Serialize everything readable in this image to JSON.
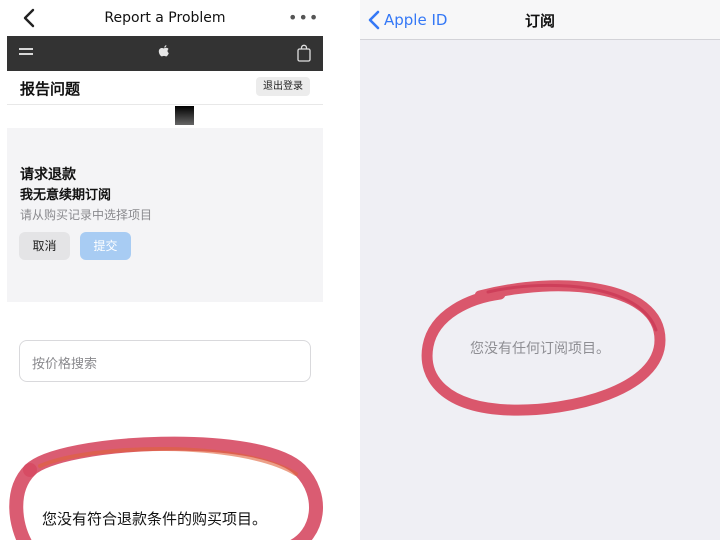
{
  "left": {
    "top_bar": {
      "title": "Report a Problem",
      "more": "•••"
    },
    "header": {
      "title": "报告问题",
      "logout_label": "退出登录"
    },
    "refund_card": {
      "title": "请求退款",
      "reason": "我无意续期订阅",
      "hint": "请从购买记录中选择项目",
      "cancel_label": "取消",
      "submit_label": "提交"
    },
    "search": {
      "placeholder": "按价格搜索"
    },
    "empty_message": "您没有符合退款条件的购买项目。",
    "icons": [
      "chevron-left-icon",
      "more-icon",
      "menu-icon",
      "apple-logo-icon",
      "bag-icon"
    ]
  },
  "right": {
    "nav": {
      "back_label": "Apple ID",
      "title": "订阅"
    },
    "empty_message": "您没有任何订阅项目。",
    "icons": [
      "chevron-left-icon"
    ]
  },
  "colors": {
    "accent": "#3478f6",
    "submit_disabled": "#a8ccf3",
    "annotation": "#d9475e",
    "navbar": "#333333"
  }
}
